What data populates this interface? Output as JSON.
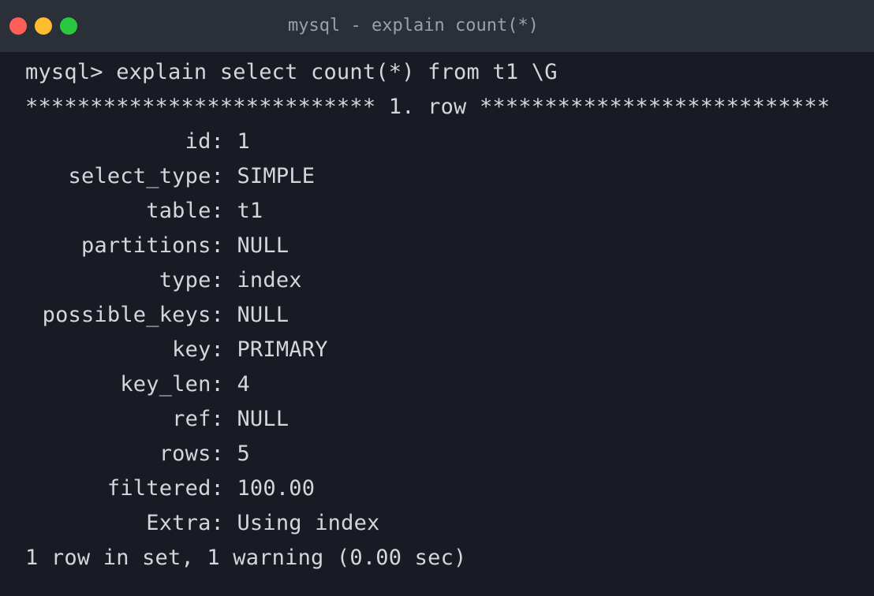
{
  "window": {
    "title": "mysql - explain count(*)",
    "traffic_lights": {
      "close_color": "#ff5f57",
      "minimize_color": "#febc2e",
      "maximize_color": "#28c840"
    }
  },
  "terminal": {
    "command": "mysql> explain select count(*) from t1 \\G",
    "row_header": "*************************** 1. row ***************************",
    "fields": [
      {
        "label": "id:",
        "value": "1"
      },
      {
        "label": "select_type:",
        "value": "SIMPLE"
      },
      {
        "label": "table:",
        "value": "t1"
      },
      {
        "label": "partitions:",
        "value": "NULL"
      },
      {
        "label": "type:",
        "value": "index"
      },
      {
        "label": "possible_keys:",
        "value": "NULL"
      },
      {
        "label": "key:",
        "value": "PRIMARY"
      },
      {
        "label": "key_len:",
        "value": "4"
      },
      {
        "label": "ref:",
        "value": "NULL"
      },
      {
        "label": "rows:",
        "value": "5"
      },
      {
        "label": "filtered:",
        "value": "100.00"
      },
      {
        "label": "Extra:",
        "value": "Using index"
      }
    ],
    "footer": "1 row in set, 1 warning (0.00 sec)"
  }
}
